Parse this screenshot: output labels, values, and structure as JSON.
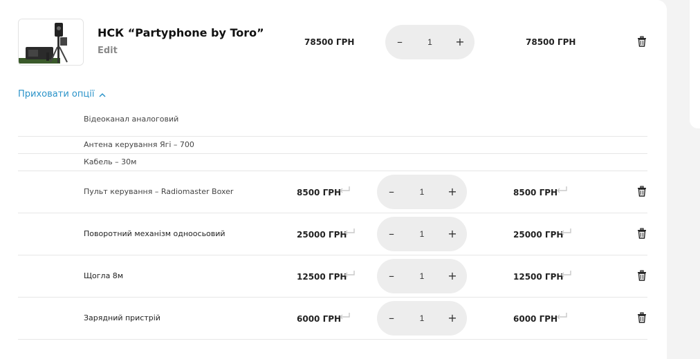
{
  "product": {
    "title": "НСК “Partyphone by Toro”",
    "edit_label": "Edit",
    "unit_price": "78500 ГРН",
    "quantity": "1",
    "total_price": "78500 ГРН"
  },
  "options_toggle": {
    "label": "Приховати опції"
  },
  "options_plain": [
    {
      "label": "Відеоканал аналоговий"
    },
    {
      "label": "Антена керування Ягі – 700"
    },
    {
      "label": "Кабель – 30м"
    }
  ],
  "options_items": [
    {
      "label": "Пульт керування – Radiomaster Boxer",
      "price": "8500 ГРН",
      "quantity": "1",
      "total": "8500 ГРН"
    },
    {
      "label": "Поворотний механізм одноосьовий",
      "price": "25000 ГРН",
      "quantity": "1",
      "total": "25000 ГРН"
    },
    {
      "label": "Щогла 8м",
      "price": "12500 ГРН",
      "quantity": "1",
      "total": "12500 ГРН"
    },
    {
      "label": "Зарядний пристрій",
      "price": "6000 ГРН",
      "quantity": "1",
      "total": "6000 ГРН"
    }
  ],
  "qty_controls": {
    "minus": "–",
    "plus": "+"
  },
  "colors": {
    "accent": "#2a93c9",
    "qty_bg": "#ededed",
    "page_bg": "#f3f3f3"
  },
  "icons": {
    "delete": "trash-icon",
    "return": "return-arrow-icon",
    "toggle": "chevron-up-icon"
  }
}
